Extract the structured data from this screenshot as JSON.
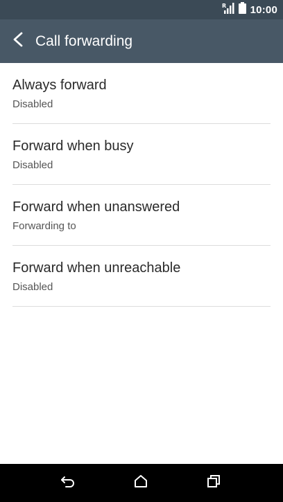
{
  "status_bar": {
    "time": "10:00",
    "icons": [
      "signal-icon",
      "battery-icon"
    ]
  },
  "app_bar": {
    "title": "Call forwarding",
    "back_icon": "back-arrow-icon"
  },
  "list": {
    "items": [
      {
        "title": "Always forward",
        "subtitle": "Disabled"
      },
      {
        "title": "Forward when busy",
        "subtitle": "Disabled"
      },
      {
        "title": "Forward when unanswered",
        "subtitle": "Forwarding to"
      },
      {
        "title": "Forward when unreachable",
        "subtitle": "Disabled"
      }
    ]
  },
  "nav_bar": {
    "buttons": [
      "back-icon",
      "home-icon",
      "recents-icon"
    ]
  },
  "colors": {
    "status_bar": "#3b4a56",
    "app_bar": "#485866",
    "divider": "#dcdcdc",
    "nav_bar": "#000000"
  }
}
